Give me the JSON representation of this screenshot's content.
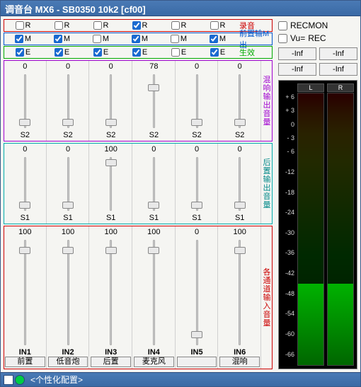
{
  "window": {
    "title": "调音台 MX6 - SB0350 10k2 [cf00]"
  },
  "rows": {
    "rec": {
      "label": "录音",
      "cells": [
        {
          "ck": false,
          "t": "R"
        },
        {
          "ck": false,
          "t": "R"
        },
        {
          "ck": false,
          "t": "R"
        },
        {
          "ck": true,
          "t": "R"
        },
        {
          "ck": false,
          "t": "R"
        },
        {
          "ck": false,
          "t": "R"
        }
      ]
    },
    "pre": {
      "label": "前置输M出",
      "cells": [
        {
          "ck": true,
          "t": "M"
        },
        {
          "ck": true,
          "t": "M"
        },
        {
          "ck": false,
          "t": "M"
        },
        {
          "ck": true,
          "t": "M"
        },
        {
          "ck": false,
          "t": "M"
        },
        {
          "ck": true,
          "t": "M"
        }
      ]
    },
    "live": {
      "label": "生效",
      "cells": [
        {
          "ck": true,
          "t": "E"
        },
        {
          "ck": true,
          "t": "E"
        },
        {
          "ck": true,
          "t": "E"
        },
        {
          "ck": true,
          "t": "E"
        },
        {
          "ck": false,
          "t": "E"
        },
        {
          "ck": true,
          "t": "E"
        }
      ]
    }
  },
  "block1": {
    "vert": "混响输出音量",
    "chans": [
      {
        "v": "0",
        "thumb": 90,
        "send": "S2"
      },
      {
        "v": "0",
        "thumb": 90,
        "send": "S2"
      },
      {
        "v": "0",
        "thumb": 90,
        "send": "S2"
      },
      {
        "v": "78",
        "thumb": 25,
        "send": "S2"
      },
      {
        "v": "0",
        "thumb": 90,
        "send": "S2"
      },
      {
        "v": "0",
        "thumb": 90,
        "send": "S2"
      }
    ]
  },
  "block2": {
    "vert": "后置 输出音量",
    "chans": [
      {
        "v": "0",
        "thumb": 90,
        "send": "S1"
      },
      {
        "v": "0",
        "thumb": 90,
        "send": "S1"
      },
      {
        "v": "100",
        "thumb": 10,
        "send": "S1"
      },
      {
        "v": "0",
        "thumb": 90,
        "send": "S1"
      },
      {
        "v": "0",
        "thumb": 90,
        "send": "S1"
      },
      {
        "v": "0",
        "thumb": 90,
        "send": "S1"
      }
    ]
  },
  "block3": {
    "vert": "各通道输入音量",
    "chans": [
      {
        "v": "100",
        "thumb": 10,
        "in": "IN1",
        "lab": "前置"
      },
      {
        "v": "100",
        "thumb": 10,
        "in": "IN2",
        "lab": "低音炮"
      },
      {
        "v": "100",
        "thumb": 10,
        "in": "IN3",
        "lab": "后置"
      },
      {
        "v": "100",
        "thumb": 10,
        "in": "IN4",
        "lab": "麦克风"
      },
      {
        "v": "0",
        "thumb": 90,
        "in": "IN5",
        "lab": ""
      },
      {
        "v": "100",
        "thumb": 10,
        "in": "IN6",
        "lab": "混响"
      }
    ]
  },
  "right": {
    "recmon": "RECMON",
    "vu": "Vu=",
    "rec": "REC",
    "inf": [
      "-Inf",
      "-Inf",
      "-Inf",
      "-Inf"
    ],
    "ticks": [
      "+ 6",
      "+ 3",
      "   0",
      "- 3",
      "- 6",
      "",
      "-12",
      "",
      "-18",
      "",
      "-24",
      "",
      "-30",
      "",
      "-36",
      "",
      "-42",
      "",
      "-48",
      "",
      "-54",
      "",
      "-60",
      "",
      "-66",
      ""
    ],
    "L": "L",
    "R": "R"
  },
  "status": {
    "text": "<个性化配置>"
  }
}
